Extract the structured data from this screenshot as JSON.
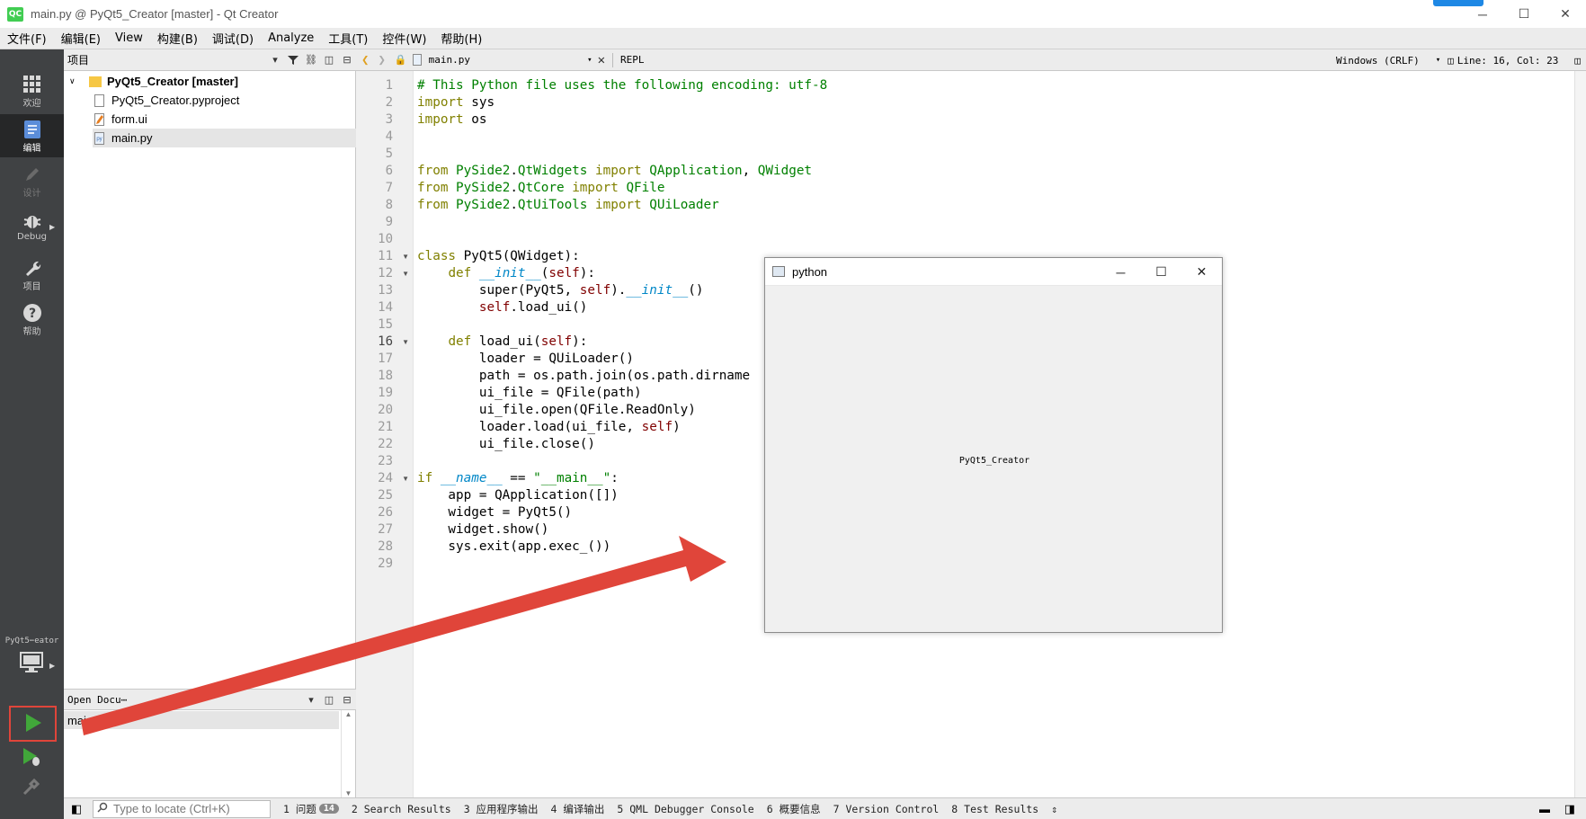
{
  "window": {
    "app_icon": "QC",
    "title": "main.py @ PyQt5_Creator [master] - Qt Creator",
    "controls": {
      "minimize": "─",
      "maximize": "☐",
      "close": "✕"
    }
  },
  "menu": [
    "文件(F)",
    "编辑(E)",
    "View",
    "构建(B)",
    "调试(D)",
    "Analyze",
    "工具(T)",
    "控件(W)",
    "帮助(H)"
  ],
  "modes": [
    {
      "label": "欢迎",
      "icon": "welcome-grid-icon"
    },
    {
      "label": "编辑",
      "icon": "edit-document-icon",
      "active": true
    },
    {
      "label": "设计",
      "icon": "design-pencil-icon",
      "disabled": true
    },
    {
      "label": "Debug",
      "icon": "debug-bug-icon"
    },
    {
      "label": "项目",
      "icon": "wrench-icon"
    },
    {
      "label": "帮助",
      "icon": "help-question-icon"
    }
  ],
  "kit": {
    "label": "PyQt5⋯eator"
  },
  "project_pane": {
    "title": "项目",
    "tree": [
      {
        "label": "PyQt5_Creator [master]",
        "type": "folder"
      },
      {
        "label": "PyQt5_Creator.pyproject",
        "type": "file"
      },
      {
        "label": "form.ui",
        "type": "ui"
      },
      {
        "label": "main.py",
        "type": "py",
        "selected": true
      }
    ]
  },
  "open_documents": {
    "title": "Open Docu⋯",
    "items": [
      "main.py"
    ]
  },
  "editor": {
    "file": "main.py",
    "repl": "REPL",
    "line_ending": "Windows (CRLF)",
    "cursor": "Line: 16, Col: 23",
    "current_line": 16
  },
  "code_lines": [
    "# This Python file uses the following encoding: utf-8",
    "import sys",
    "import os",
    "",
    "",
    "from PySide2.QtWidgets import QApplication, QWidget",
    "from PySide2.QtCore import QFile",
    "from PySide2.QtUiTools import QUiLoader",
    "",
    "",
    "class PyQt5(QWidget):",
    "    def __init__(self):",
    "        super(PyQt5, self).__init__()",
    "        self.load_ui()",
    "",
    "    def load_ui(self):",
    "        loader = QUiLoader()",
    "        path = os.path.join(os.path.dirname",
    "        ui_file = QFile(path)",
    "        ui_file.open(QFile.ReadOnly)",
    "        loader.load(ui_file, self)",
    "        ui_file.close()",
    "",
    "if __name__ == \"__main__\":",
    "    app = QApplication([])",
    "    widget = PyQt5()",
    "    widget.show()",
    "    sys.exit(app.exec_())",
    ""
  ],
  "python_window": {
    "title": "python",
    "label": "PyQt5_Creator",
    "controls": {
      "minimize": "─",
      "maximize": "☐",
      "close": "✕"
    }
  },
  "statusbar": {
    "locator_placeholder": "Type to locate (Ctrl+K)",
    "items": [
      {
        "text": "1 问题",
        "badge": "14"
      },
      {
        "text": "2 Search Results"
      },
      {
        "text": "3 应用程序输出"
      },
      {
        "text": "4 编译输出"
      },
      {
        "text": "5 QML Debugger Console"
      },
      {
        "text": "6 概要信息"
      },
      {
        "text": "7 Version Control"
      },
      {
        "text": "8 Test Results"
      }
    ]
  },
  "colors": {
    "annotation_red": "#e0453a",
    "sidebar": "#404244",
    "run_green": "#41a73a"
  }
}
